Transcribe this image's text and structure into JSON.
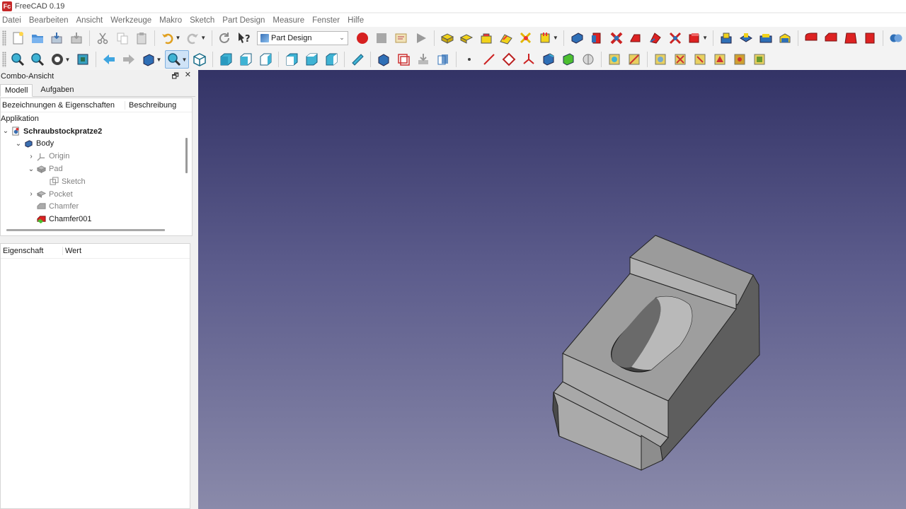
{
  "window": {
    "title": "FreeCAD 0.19",
    "logo_text": "Fc"
  },
  "menu": [
    "Datei",
    "Bearbeiten",
    "Ansicht",
    "Werkzeuge",
    "Makro",
    "Sketch",
    "Part Design",
    "Measure",
    "Fenster",
    "Hilfe"
  ],
  "toolbar": {
    "workbench": "Part Design"
  },
  "combo": {
    "title": "Combo-Ansicht",
    "float_icon": "🗗",
    "close_icon": "✕",
    "tabs": [
      "Modell",
      "Aufgaben"
    ],
    "tree": {
      "col1": "Bezeichnungen & Eigenschaften",
      "col2": "Beschreibung",
      "root": "Applikation",
      "items": [
        {
          "label": "Schraubstockpratze2",
          "icon": "document-icon",
          "twisty": "⌄"
        },
        {
          "label": "Body",
          "icon": "body-icon",
          "twisty": "⌄"
        },
        {
          "label": "Origin",
          "icon": "origin-icon",
          "twisty": "›"
        },
        {
          "label": "Pad",
          "icon": "pad-icon",
          "twisty": "⌄"
        },
        {
          "label": "Sketch",
          "icon": "sketch-icon",
          "twisty": ""
        },
        {
          "label": "Pocket",
          "icon": "pocket-icon",
          "twisty": "›"
        },
        {
          "label": "Chamfer",
          "icon": "chamfer-icon",
          "twisty": ""
        },
        {
          "label": "Chamfer001",
          "icon": "chamfer-active-icon",
          "twisty": ""
        }
      ]
    },
    "props": {
      "col1": "Eigenschaft",
      "col2": "Wert"
    }
  },
  "colors": {
    "bg_top": "#333366",
    "bg_bottom": "#8a8aaa",
    "part_grey": "#a8a8a8"
  }
}
